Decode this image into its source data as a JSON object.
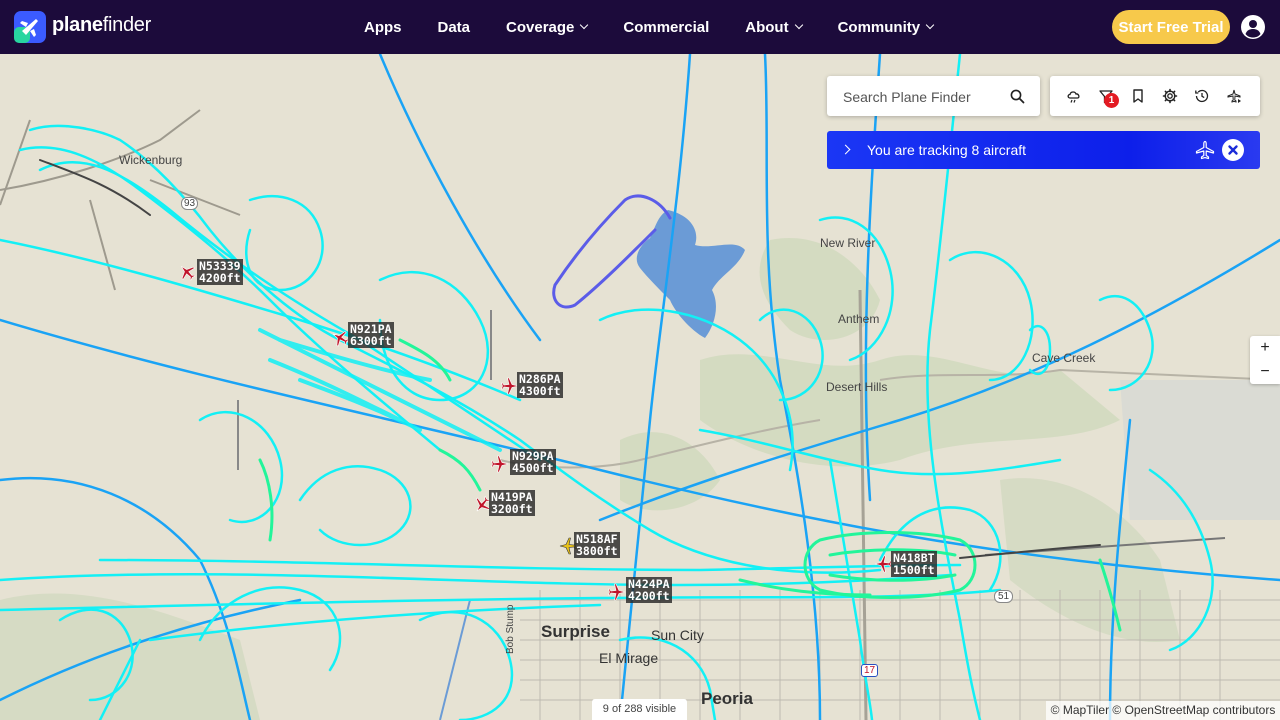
{
  "brand": {
    "name_bold": "plane",
    "name_regular": "finder"
  },
  "nav": {
    "items": [
      {
        "label": "Apps",
        "dropdown": false
      },
      {
        "label": "Data",
        "dropdown": false
      },
      {
        "label": "Coverage",
        "dropdown": true
      },
      {
        "label": "Commercial",
        "dropdown": false
      },
      {
        "label": "About",
        "dropdown": true
      },
      {
        "label": "Community",
        "dropdown": true
      }
    ],
    "trial_label": "Start Free Trial"
  },
  "search": {
    "placeholder": "Search Plane Finder"
  },
  "toolbar": {
    "icons": [
      "weather-icon",
      "filter-icon",
      "bookmark-icon",
      "settings-icon",
      "history-icon",
      "playback-icon"
    ],
    "filter_badge": "1"
  },
  "tracking": {
    "text": "You are tracking 8 aircraft"
  },
  "zoom": {
    "in": "+",
    "out": "−"
  },
  "places": {
    "wickenburg": "Wickenburg",
    "new_river": "New River",
    "anthem": "Anthem",
    "desert_hills": "Desert Hills",
    "cave_creek": "Cave Creek",
    "surprise": "Surprise",
    "sun_city": "Sun City",
    "el_mirage": "El Mirage",
    "peoria": "Peoria",
    "bob_stump": "Bob Stump",
    "shield_51": "51",
    "shield_17": "17",
    "shield_93": "93"
  },
  "aircraft": [
    {
      "callsign": "N53339",
      "altitude": "4200ft",
      "color": "#c0152a"
    },
    {
      "callsign": "N921PA",
      "altitude": "6300ft",
      "color": "#c0152a"
    },
    {
      "callsign": "N286PA",
      "altitude": "4300ft",
      "color": "#c0152a"
    },
    {
      "callsign": "N929PA",
      "altitude": "4500ft",
      "color": "#c0152a"
    },
    {
      "callsign": "N419PA",
      "altitude": "3200ft",
      "color": "#c0152a"
    },
    {
      "callsign": "N518AF",
      "altitude": "3800ft",
      "color": "#e8c21a"
    },
    {
      "callsign": "N424PA",
      "altitude": "4200ft",
      "color": "#c0152a"
    },
    {
      "callsign": "N418BT",
      "altitude": "1500ft",
      "color": "#c0152a"
    }
  ],
  "footer": {
    "visible": "9 of 288 visible",
    "attribution": "© MapTiler © OpenStreetMap contributors"
  },
  "colors": {
    "nav_bg": "#1c0b3b",
    "trial_bg": "#f7c94b",
    "tracking_bg": "#1b37f5",
    "track_cyan": "#13f0f5",
    "track_blue": "#1aa3f5",
    "track_green": "#22f59a"
  }
}
